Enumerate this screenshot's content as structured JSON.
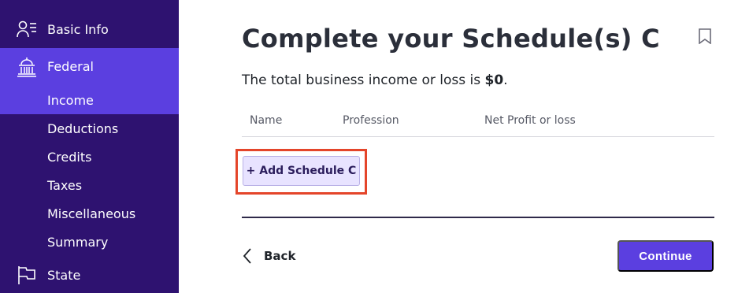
{
  "sidebar": {
    "basic_info": {
      "label": "Basic Info",
      "icon": "person-list-icon"
    },
    "federal": {
      "label": "Federal",
      "icon": "capitol-building-icon"
    },
    "federal_items": [
      "Income",
      "Deductions",
      "Credits",
      "Taxes",
      "Miscellaneous",
      "Summary"
    ],
    "state": {
      "label": "State",
      "icon": "flag-icon"
    }
  },
  "main": {
    "title": "Complete your Schedule(s) C",
    "summary_prefix": "The total business income or loss is ",
    "summary_value": "$0",
    "summary_suffix": ".",
    "columns": [
      "Name",
      "Profession",
      "Net Profit or loss"
    ],
    "add_button": "+ Add Schedule C",
    "back_label": "Back",
    "continue_label": "Continue"
  },
  "colors": {
    "sidebar_bg": "#2e1270",
    "sidebar_active": "#5b3fe0",
    "accent": "#5b3fe0",
    "highlight": "#e4452a"
  }
}
